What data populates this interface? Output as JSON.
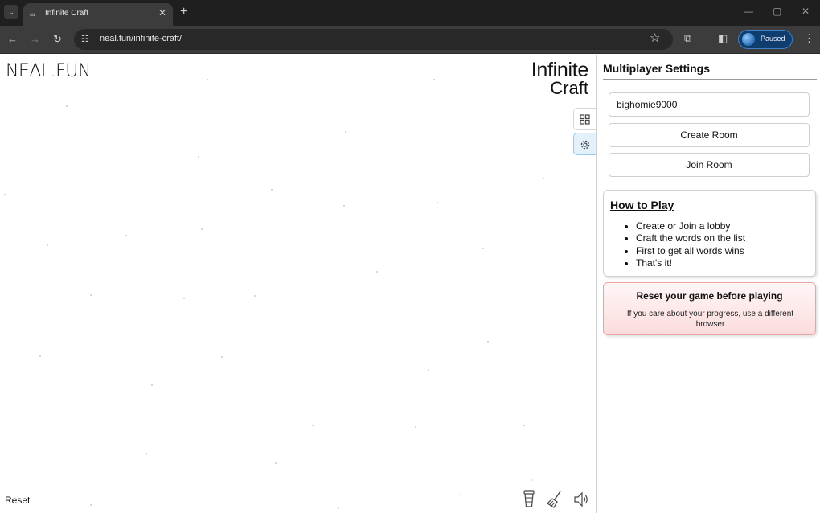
{
  "browser": {
    "tab_title": "Infinite Craft",
    "url": "neal.fun/infinite-craft/",
    "profile_status": "Paused",
    "icons": {
      "tab_search": "chevron-down-icon",
      "favicon": "infinity-icon",
      "close": "close-icon",
      "new_tab": "plus-icon",
      "back": "arrow-left-icon",
      "forward": "arrow-right-icon",
      "reload": "reload-icon",
      "site_info": "tune-icon",
      "bookmark": "star-icon",
      "extensions": "puzzle-icon",
      "side_panel": "side-panel-icon",
      "menu": "kebab-menu-icon"
    },
    "glyphs": {
      "tab_search": "⌄",
      "favicon": "∞",
      "close": "✕",
      "new_tab": "+",
      "minimize": "—",
      "maximize": "▢",
      "window_close": "✕",
      "back": "←",
      "forward": "→",
      "reload": "↻",
      "site_info": "☷",
      "bookmark": "☆",
      "extensions": "⧉",
      "side_panel": "◧",
      "menu": "⋮"
    }
  },
  "game": {
    "brand": "NEAL.FUN",
    "logo_line1": "Infinite",
    "logo_line2": "Craft",
    "reset_label": "Reset",
    "side_buttons": [
      "grid-icon",
      "gear-icon"
    ],
    "bottom_icons": [
      "cup-icon",
      "broom-icon",
      "speaker-icon"
    ]
  },
  "panel": {
    "title": "Multiplayer Settings",
    "name_value": "bighomie9000",
    "create_room": "Create Room",
    "join_room": "Join Room",
    "how_to_play": {
      "title": "How to Play",
      "steps": [
        "Create or Join a lobby",
        "Craft the words on the list",
        "First to get all words wins",
        "That's it!"
      ]
    },
    "warning": {
      "title": "Reset your game before playing",
      "text": "If you care about your progress, use a different browser"
    }
  },
  "colors": {
    "chrome_dark": "#1f1f1f",
    "toolbar": "#3c3c3c",
    "profile_chip": "#0f3d6e",
    "active_side_button": "#e3f1fb",
    "warning_bg": "#fbdcdc",
    "warning_border": "#e8a3a3"
  }
}
